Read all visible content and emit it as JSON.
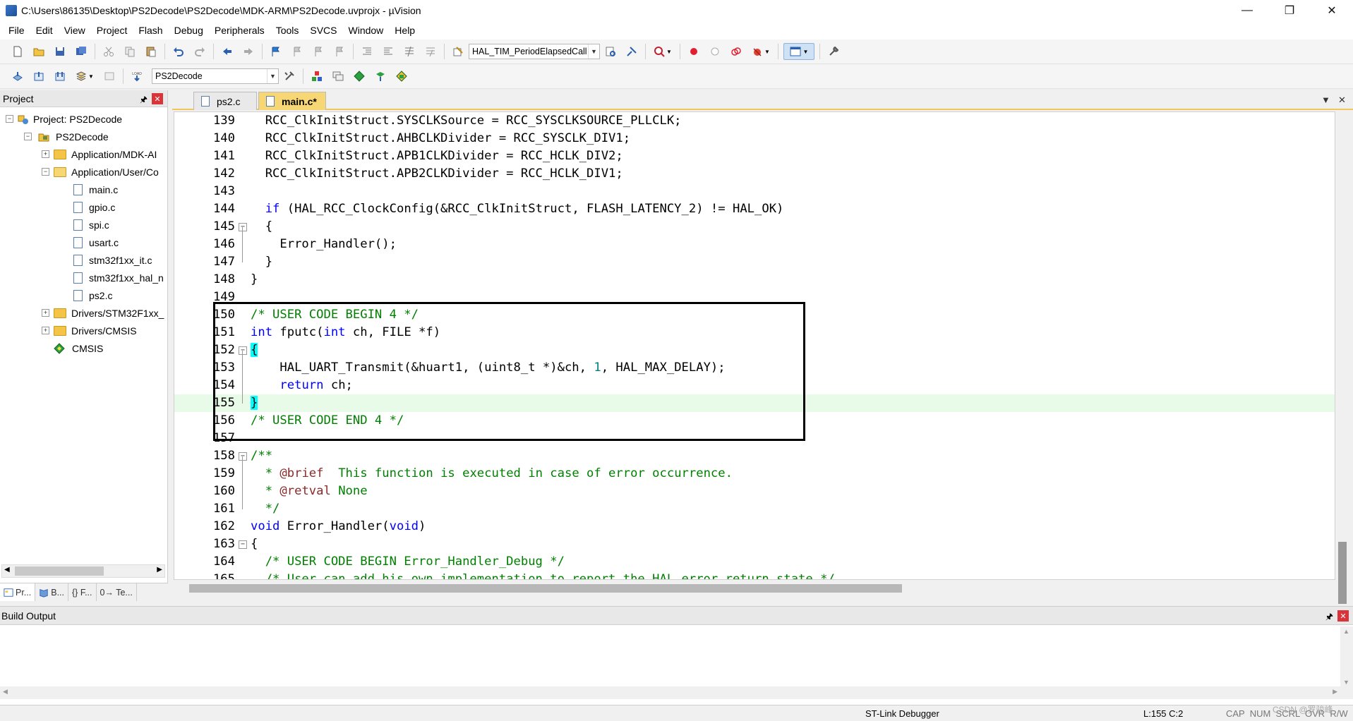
{
  "window": {
    "title": "C:\\Users\\86135\\Desktop\\PS2Decode\\PS2Decode\\MDK-ARM\\PS2Decode.uvprojx - µVision",
    "controls": [
      "—",
      "❐",
      "✕"
    ]
  },
  "menu": [
    "File",
    "Edit",
    "View",
    "Project",
    "Flash",
    "Debug",
    "Peripherals",
    "Tools",
    "SVCS",
    "Window",
    "Help"
  ],
  "toolbar": {
    "function_combo": "HAL_TIM_PeriodElapsedCall",
    "target_combo": "PS2Decode"
  },
  "project_panel": {
    "title": "Project",
    "pin": "🖈",
    "close": "✕",
    "tree": [
      {
        "label": "Project: PS2Decode",
        "level": 0,
        "expander": "−",
        "icon": "project-icon"
      },
      {
        "label": "PS2Decode",
        "level": 1,
        "expander": "−",
        "icon": "target-folder-icon"
      },
      {
        "label": "Application/MDK-AI",
        "level": 2,
        "expander": "+",
        "icon": "folder-icon"
      },
      {
        "label": "Application/User/Co",
        "level": 2,
        "expander": "−",
        "icon": "folder-open-icon"
      },
      {
        "label": "main.c",
        "level": 3,
        "expander": "",
        "icon": "file-icon"
      },
      {
        "label": "gpio.c",
        "level": 3,
        "expander": "",
        "icon": "file-icon"
      },
      {
        "label": "spi.c",
        "level": 3,
        "expander": "",
        "icon": "file-icon"
      },
      {
        "label": "usart.c",
        "level": 3,
        "expander": "",
        "icon": "file-icon"
      },
      {
        "label": "stm32f1xx_it.c",
        "level": 3,
        "expander": "",
        "icon": "file-icon"
      },
      {
        "label": "stm32f1xx_hal_n",
        "level": 3,
        "expander": "",
        "icon": "file-icon"
      },
      {
        "label": "ps2.c",
        "level": 3,
        "expander": "",
        "icon": "file-icon"
      },
      {
        "label": "Drivers/STM32F1xx_",
        "level": 2,
        "expander": "+",
        "icon": "folder-icon"
      },
      {
        "label": "Drivers/CMSIS",
        "level": 2,
        "expander": "+",
        "icon": "folder-icon"
      },
      {
        "label": "CMSIS",
        "level": 2,
        "expander": "",
        "icon": "gem-icon"
      }
    ],
    "tabs": [
      "Pr...",
      "B...",
      "{} F...",
      "0→ Te..."
    ]
  },
  "editor": {
    "tabs": [
      {
        "label": "ps2.c",
        "active": false
      },
      {
        "label": "main.c*",
        "active": true
      }
    ],
    "lines": [
      {
        "n": "139",
        "code": "  RCC_ClkInitStruct.SYSCLKSource = RCC_SYSCLKSOURCE_PLLCLK;"
      },
      {
        "n": "140",
        "code": "  RCC_ClkInitStruct.AHBCLKDivider = RCC_SYSCLK_DIV1;"
      },
      {
        "n": "141",
        "code": "  RCC_ClkInitStruct.APB1CLKDivider = RCC_HCLK_DIV2;"
      },
      {
        "n": "142",
        "code": "  RCC_ClkInitStruct.APB2CLKDivider = RCC_HCLK_DIV1;"
      },
      {
        "n": "143",
        "code": ""
      },
      {
        "n": "144",
        "code": "  if (HAL_RCC_ClockConfig(&RCC_ClkInitStruct, FLASH_LATENCY_2) != HAL_OK)"
      },
      {
        "n": "145",
        "code": "  {"
      },
      {
        "n": "146",
        "code": "    Error_Handler();"
      },
      {
        "n": "147",
        "code": "  }"
      },
      {
        "n": "148",
        "code": "}"
      },
      {
        "n": "149",
        "code": ""
      },
      {
        "n": "150",
        "code": "/* USER CODE BEGIN 4 */"
      },
      {
        "n": "151",
        "code": "int fputc(int ch, FILE *f)"
      },
      {
        "n": "152",
        "code": "{"
      },
      {
        "n": "153",
        "code": "    HAL_UART_Transmit(&huart1, (uint8_t *)&ch, 1, HAL_MAX_DELAY);"
      },
      {
        "n": "154",
        "code": "    return ch;"
      },
      {
        "n": "155",
        "code": "}"
      },
      {
        "n": "156",
        "code": "/* USER CODE END 4 */"
      },
      {
        "n": "157",
        "code": ""
      },
      {
        "n": "158",
        "code": "/**"
      },
      {
        "n": "159",
        "code": "  * @brief  This function is executed in case of error occurrence."
      },
      {
        "n": "160",
        "code": "  * @retval None"
      },
      {
        "n": "161",
        "code": "  */"
      },
      {
        "n": "162",
        "code": "void Error_Handler(void)"
      },
      {
        "n": "163",
        "code": "{"
      },
      {
        "n": "164",
        "code": "  /* USER CODE BEGIN Error_Handler_Debug */"
      },
      {
        "n": "165",
        "code": "  /* User can add his own implementation to report the HAL error return state */"
      }
    ]
  },
  "build_output": {
    "title": "Build Output"
  },
  "status": {
    "debugger": "ST-Link Debugger",
    "position": "L:155 C:2",
    "flags": "CAP  NUM  SCRL  OVR  R/W",
    "watermark": "CSDN @罗骏峰"
  },
  "colors": {
    "keyword": "#0000ff",
    "comment": "#008000",
    "doc_tag": "#8b2a2a",
    "number": "#008080",
    "active_tab": "#f7d774",
    "current_line": "#e8fbe9",
    "brace_match": "#00ffff"
  }
}
